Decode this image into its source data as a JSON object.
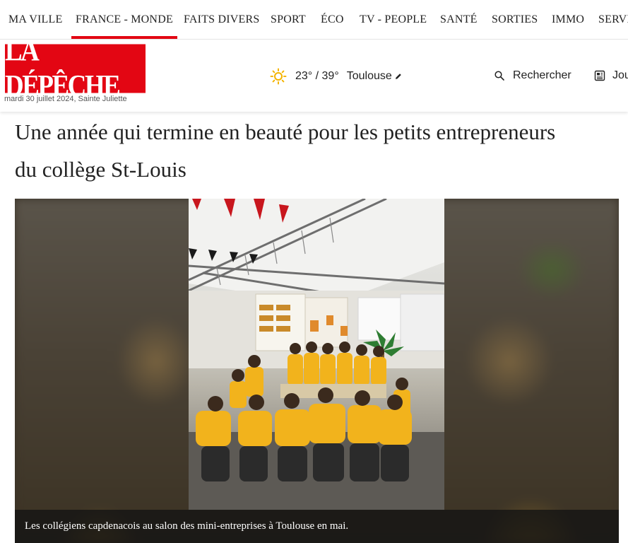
{
  "nav": {
    "items": [
      {
        "label": "MA VILLE",
        "active": false
      },
      {
        "label": "FRANCE - MONDE",
        "active": true
      },
      {
        "label": "FAITS DIVERS",
        "active": false
      },
      {
        "label": "SPORT",
        "active": false
      },
      {
        "label": "ÉCO",
        "active": false
      },
      {
        "label": "TV - PEOPLE",
        "active": false
      },
      {
        "label": "SANTÉ",
        "active": false
      },
      {
        "label": "SORTIES",
        "active": false
      },
      {
        "label": "IMMO",
        "active": false
      },
      {
        "label": "SERVI",
        "active": false
      }
    ]
  },
  "header": {
    "logo_text": "LA DÉPÊCHE",
    "date": "mardi 30 juillet 2024, Sainte Juliette",
    "weather": {
      "icon": "sun-icon",
      "temperature": "23° / 39°",
      "city": "Toulouse"
    },
    "search_label": "Rechercher",
    "journal_label": "Jou"
  },
  "article": {
    "headline": "Une année qui termine en beauté pour les petits entrepreneurs du collège St-Louis",
    "caption": "Les collégiens capdenacois au salon des mini-entreprises à Toulouse en mai."
  },
  "colors": {
    "brand_red": "#e30613",
    "student_shirt": "#f2b31c"
  }
}
